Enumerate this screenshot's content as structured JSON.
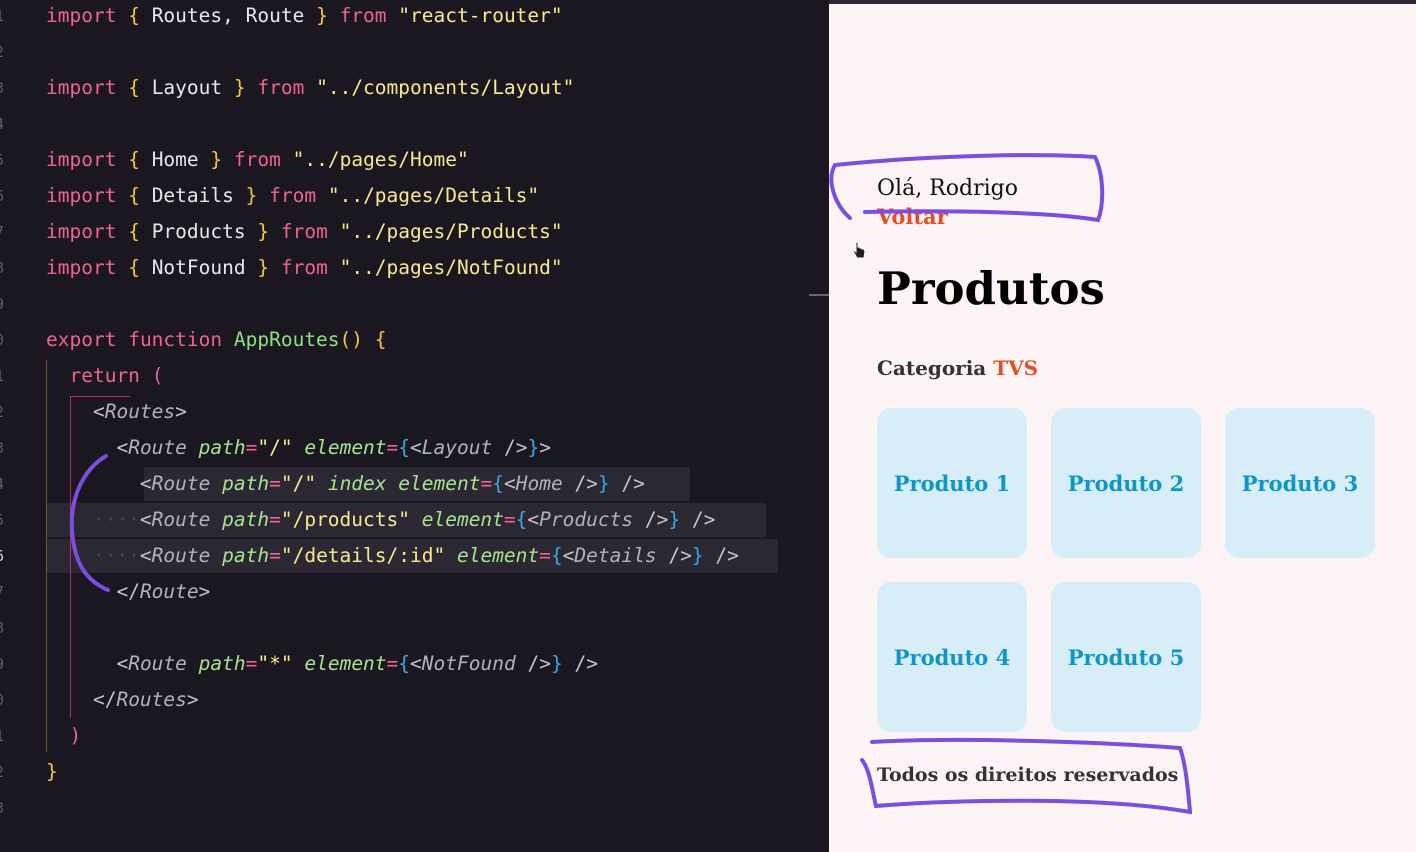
{
  "editor": {
    "line_numbers": [
      "1",
      "2",
      "3",
      "4",
      "5",
      "6",
      "7",
      "8",
      "9",
      "0",
      "1",
      "2",
      "3",
      "4",
      "5",
      "6",
      "7",
      "8",
      "9",
      "0",
      "1",
      "2",
      "3"
    ],
    "lines": [
      [
        [
          "k",
          "import"
        ],
        [
          "p",
          " "
        ],
        [
          "b",
          "{"
        ],
        [
          "p",
          " Routes, Route "
        ],
        [
          "b",
          "}"
        ],
        [
          "p",
          " "
        ],
        [
          "k",
          "from"
        ],
        [
          "p",
          " "
        ],
        [
          "s",
          "\"react-router\""
        ]
      ],
      [],
      [
        [
          "k",
          "import"
        ],
        [
          "p",
          " "
        ],
        [
          "b",
          "{"
        ],
        [
          "p",
          " Layout "
        ],
        [
          "b",
          "}"
        ],
        [
          "p",
          " "
        ],
        [
          "k",
          "from"
        ],
        [
          "p",
          " "
        ],
        [
          "s",
          "\"../components/Layout\""
        ]
      ],
      [],
      [
        [
          "k",
          "import"
        ],
        [
          "p",
          " "
        ],
        [
          "b",
          "{"
        ],
        [
          "p",
          " Home "
        ],
        [
          "b",
          "}"
        ],
        [
          "p",
          " "
        ],
        [
          "k",
          "from"
        ],
        [
          "p",
          " "
        ],
        [
          "s",
          "\"../pages/Home\""
        ]
      ],
      [
        [
          "k",
          "import"
        ],
        [
          "p",
          " "
        ],
        [
          "b",
          "{"
        ],
        [
          "p",
          " Details "
        ],
        [
          "b",
          "}"
        ],
        [
          "p",
          " "
        ],
        [
          "k",
          "from"
        ],
        [
          "p",
          " "
        ],
        [
          "s",
          "\"../pages/Details\""
        ]
      ],
      [
        [
          "k",
          "import"
        ],
        [
          "p",
          " "
        ],
        [
          "b",
          "{"
        ],
        [
          "p",
          " Products "
        ],
        [
          "b",
          "}"
        ],
        [
          "p",
          " "
        ],
        [
          "k",
          "from"
        ],
        [
          "p",
          " "
        ],
        [
          "s",
          "\"../pages/Products\""
        ]
      ],
      [
        [
          "k",
          "import"
        ],
        [
          "p",
          " "
        ],
        [
          "b",
          "{"
        ],
        [
          "p",
          " NotFound "
        ],
        [
          "b",
          "}"
        ],
        [
          "p",
          " "
        ],
        [
          "k",
          "from"
        ],
        [
          "p",
          " "
        ],
        [
          "s",
          "\"../pages/NotFound\""
        ]
      ],
      [],
      [
        [
          "k",
          "export"
        ],
        [
          "p",
          " "
        ],
        [
          "k",
          "function"
        ],
        [
          "p",
          " "
        ],
        [
          "f",
          "AppRoutes"
        ],
        [
          "b",
          "()"
        ],
        [
          "p",
          " "
        ],
        [
          "b",
          "{"
        ]
      ],
      [
        [
          "p",
          "  "
        ],
        [
          "k",
          "return"
        ],
        [
          "p",
          " "
        ],
        [
          "m",
          "("
        ]
      ],
      [
        [
          "p",
          "    "
        ],
        [
          "g",
          "<"
        ],
        [
          "t",
          "Routes"
        ],
        [
          "g",
          ">"
        ]
      ],
      [
        [
          "p",
          "      "
        ],
        [
          "g",
          "<"
        ],
        [
          "t",
          "Route"
        ],
        [
          "p",
          " "
        ],
        [
          "a",
          "path"
        ],
        [
          "o",
          "="
        ],
        [
          "s",
          "\"/\""
        ],
        [
          "p",
          " "
        ],
        [
          "a",
          "element"
        ],
        [
          "o",
          "="
        ],
        [
          "c",
          "{"
        ],
        [
          "g",
          "<"
        ],
        [
          "t",
          "Layout"
        ],
        [
          "p",
          " "
        ],
        [
          "g",
          "/>"
        ],
        [
          "c",
          "}"
        ],
        [
          "g",
          ">"
        ]
      ],
      [
        [
          "p",
          "        "
        ],
        [
          "g",
          "<"
        ],
        [
          "t",
          "Route"
        ],
        [
          "p",
          " "
        ],
        [
          "a",
          "path"
        ],
        [
          "o",
          "="
        ],
        [
          "s",
          "\"/\""
        ],
        [
          "p",
          " "
        ],
        [
          "a",
          "index"
        ],
        [
          "p",
          " "
        ],
        [
          "a",
          "element"
        ],
        [
          "o",
          "="
        ],
        [
          "c",
          "{"
        ],
        [
          "g",
          "<"
        ],
        [
          "t",
          "Home"
        ],
        [
          "p",
          " "
        ],
        [
          "g",
          "/>"
        ],
        [
          "c",
          "}"
        ],
        [
          "p",
          " "
        ],
        [
          "g",
          "/>"
        ]
      ],
      [
        [
          "dots",
          "    ····"
        ],
        [
          "g",
          "<"
        ],
        [
          "t",
          "Route"
        ],
        [
          "p",
          " "
        ],
        [
          "a",
          "path"
        ],
        [
          "o",
          "="
        ],
        [
          "s",
          "\"/products\""
        ],
        [
          "p",
          " "
        ],
        [
          "a",
          "element"
        ],
        [
          "o",
          "="
        ],
        [
          "c",
          "{"
        ],
        [
          "g",
          "<"
        ],
        [
          "t",
          "Products"
        ],
        [
          "p",
          " "
        ],
        [
          "g",
          "/>"
        ],
        [
          "c",
          "}"
        ],
        [
          "p",
          " "
        ],
        [
          "g",
          "/>"
        ]
      ],
      [
        [
          "dots",
          "    ····"
        ],
        [
          "g",
          "<"
        ],
        [
          "t",
          "Route"
        ],
        [
          "p",
          " "
        ],
        [
          "a",
          "path"
        ],
        [
          "o",
          "="
        ],
        [
          "s",
          "\"/details/:id\""
        ],
        [
          "p",
          " "
        ],
        [
          "a",
          "element"
        ],
        [
          "o",
          "="
        ],
        [
          "c",
          "{"
        ],
        [
          "g",
          "<"
        ],
        [
          "t",
          "Details"
        ],
        [
          "p",
          " "
        ],
        [
          "g",
          "/>"
        ],
        [
          "c",
          "}"
        ],
        [
          "p",
          " "
        ],
        [
          "g",
          "/>"
        ]
      ],
      [
        [
          "p",
          "      "
        ],
        [
          "g",
          "</"
        ],
        [
          "t",
          "Route"
        ],
        [
          "g",
          ">"
        ]
      ],
      [],
      [
        [
          "p",
          "      "
        ],
        [
          "g",
          "<"
        ],
        [
          "t",
          "Route"
        ],
        [
          "p",
          " "
        ],
        [
          "a",
          "path"
        ],
        [
          "o",
          "="
        ],
        [
          "s",
          "\"*\""
        ],
        [
          "p",
          " "
        ],
        [
          "a",
          "element"
        ],
        [
          "o",
          "="
        ],
        [
          "c",
          "{"
        ],
        [
          "g",
          "<"
        ],
        [
          "t",
          "NotFound"
        ],
        [
          "p",
          " "
        ],
        [
          "g",
          "/>"
        ],
        [
          "c",
          "}"
        ],
        [
          "p",
          " "
        ],
        [
          "g",
          "/>"
        ]
      ],
      [
        [
          "p",
          "    "
        ],
        [
          "g",
          "</"
        ],
        [
          "t",
          "Routes"
        ],
        [
          "g",
          ">"
        ]
      ],
      [
        [
          "p",
          "  "
        ],
        [
          "m",
          ")"
        ]
      ],
      [
        [
          "b",
          "}"
        ]
      ],
      []
    ]
  },
  "preview": {
    "greeting": "Olá, Rodrigo",
    "back_link": "Voltar",
    "page_title": "Produtos",
    "category_label": "Categoria",
    "category_value": "TVS",
    "products": [
      "Produto 1",
      "Produto 2",
      "Produto 3",
      "Produto 4",
      "Produto 5"
    ],
    "footer": "Todos os direitos reservados"
  },
  "colors": {
    "accent_orange": "#e04f26",
    "card_bg": "#d7eef8",
    "card_text": "#0e96c9",
    "annotation_purple": "#7b4ee0"
  }
}
